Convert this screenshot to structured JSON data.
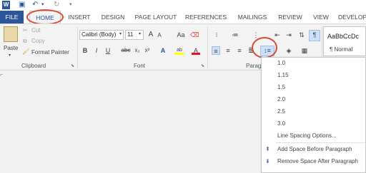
{
  "qat": {
    "word_icon": "word-app-icon",
    "save_icon": "save-icon",
    "undo_icon": "undo-icon",
    "redo_icon": "redo-icon"
  },
  "tabs": [
    "FILE",
    "HOME",
    "INSERT",
    "DESIGN",
    "PAGE LAYOUT",
    "REFERENCES",
    "MAILINGS",
    "REVIEW",
    "VIEW",
    "DEVELOP"
  ],
  "clipboard": {
    "paste": "Paste",
    "cut": "Cut",
    "copy": "Copy",
    "format_painter": "Format Painter",
    "label": "Clipboard"
  },
  "font": {
    "family": "Calibri (Body)",
    "size": "11",
    "grow": "A",
    "shrink": "A",
    "case": "Aa",
    "bold": "B",
    "italic": "I",
    "underline": "U",
    "strike": "abc",
    "subscript": "x₂",
    "superscript": "x²",
    "text_effects": "A",
    "highlight": "ab",
    "color": "A",
    "label": "Font"
  },
  "paragraph": {
    "label": "Paragraph",
    "label_visible": "Parag",
    "pilcrow": "¶",
    "line_spacing_icon": "line-spacing-icon"
  },
  "styles": {
    "preview": "AaBbCcDc",
    "normal": "¶ Normal"
  },
  "line_spacing_menu": {
    "options": [
      "1.0",
      "1.15",
      "1.5",
      "2.0",
      "2.5",
      "3.0"
    ],
    "more": "Line Spacing Options...",
    "add_before": "Add Space Before Paragraph",
    "remove_after": "Remove Space After Paragraph"
  },
  "colors": {
    "accent": "#2b579a",
    "highlight_circle": "#d84a38",
    "ribbon_bg": "#f3f3f3",
    "canvas_bg": "#f1f1f1"
  }
}
